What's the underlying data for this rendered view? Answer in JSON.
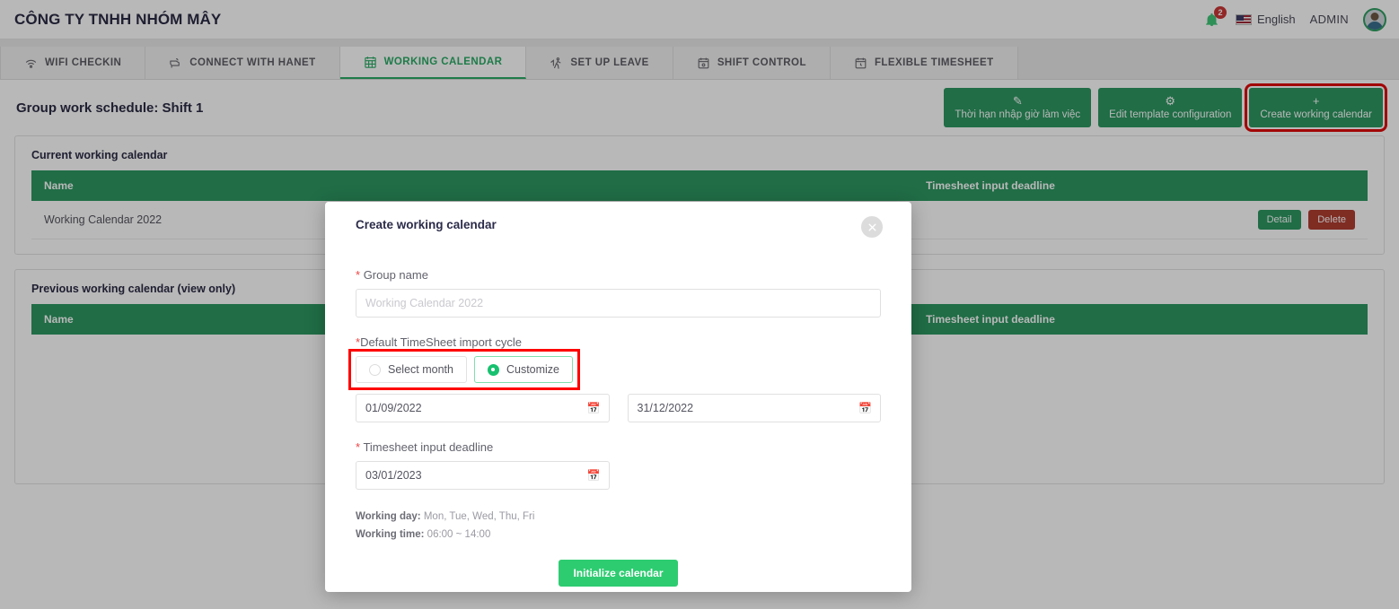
{
  "header": {
    "company_title": "CÔNG TY TNHH NHÓM MÂY",
    "notification_count": "2",
    "bell_icon": "bell-icon",
    "flag_icon": "us-flag-icon",
    "language": "English",
    "admin_label": "ADMIN",
    "avatar_icon": "user-avatar-icon"
  },
  "tabs": [
    {
      "label": "WIFI CHECKIN",
      "icon": "wifi-icon",
      "active": false
    },
    {
      "label": "CONNECT WITH HANET",
      "icon": "camera-icon",
      "active": false
    },
    {
      "label": "WORKING CALENDAR",
      "icon": "calendar-grid-icon",
      "active": true
    },
    {
      "label": "SET UP LEAVE",
      "icon": "person-walk-icon",
      "active": false
    },
    {
      "label": "SHIFT CONTROL",
      "icon": "calendar-gear-icon",
      "active": false
    },
    {
      "label": "FLEXIBLE TIMESHEET",
      "icon": "calendar-clock-icon",
      "active": false
    }
  ],
  "page": {
    "title": "Group work schedule: Shift 1",
    "toolbar": [
      {
        "label": "Thời hạn nhập giờ làm việc",
        "icon": "edit-square-icon",
        "highlight": false
      },
      {
        "label": "Edit template configuration",
        "icon": "gear-icon",
        "highlight": false
      },
      {
        "label": "Create working calendar",
        "icon": "plus-icon",
        "highlight": true
      }
    ]
  },
  "current_calendar": {
    "section_label": "Current working calendar",
    "columns": [
      "Name",
      "",
      "",
      "Timesheet input deadline",
      ""
    ],
    "rows": [
      {
        "name": "Working Calendar 2022",
        "deadline": "",
        "detail_label": "Detail",
        "delete_label": "Delete"
      }
    ]
  },
  "previous_calendar": {
    "section_label": "Previous working calendar (view only)",
    "columns": [
      "Name",
      "",
      "",
      "Timesheet input deadline",
      ""
    ],
    "rows": []
  },
  "modal": {
    "title": "Create working calendar",
    "close_icon": "close-circle-icon",
    "group_name": {
      "label": "Group name",
      "required": true,
      "value": "",
      "placeholder": "Working Calendar 2022"
    },
    "import_cycle": {
      "label": "Default TimeSheet import cycle",
      "required": true,
      "options": [
        {
          "label": "Select month",
          "selected": false
        },
        {
          "label": "Customize",
          "selected": true
        }
      ],
      "start_date": "01/09/2022",
      "end_date": "31/12/2022",
      "calendar_icon": "calendar-icon"
    },
    "deadline": {
      "label": "Timesheet input deadline",
      "required": true,
      "value": "03/01/2023",
      "calendar_icon": "calendar-icon"
    },
    "meta": {
      "working_day_label": "Working day:",
      "working_day_value": "Mon, Tue, Wed, Thu, Fri",
      "working_time_label": "Working time:",
      "working_time_value": "06:00 ~ 14:00"
    },
    "submit_label": "Initialize calendar"
  },
  "colors": {
    "brand_green": "#1f9c5d",
    "accent_green": "#2ecc71",
    "danger_red": "#c0392b",
    "highlight_red": "#ff0000",
    "title_navy": "#2b2b4a"
  }
}
